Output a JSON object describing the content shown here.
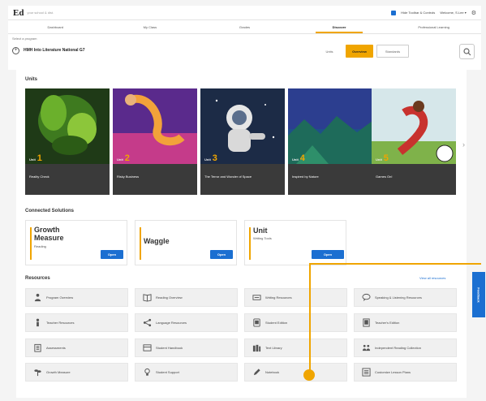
{
  "header": {
    "logo": "Ed",
    "org": "your school & dist.",
    "controls_label": "Hide Toolbar & Controls",
    "user": "Welcome, S.Lee ▾"
  },
  "nav": {
    "tabs": [
      "Dashboard",
      "My Class",
      "Grades",
      "Discover",
      "Professional Learning"
    ],
    "active_index": 3
  },
  "program": {
    "caption": "Select a program",
    "title": "HMH Into Literature National G7",
    "view_options": [
      "Units",
      "Overview",
      "Standards"
    ],
    "active_view": 1
  },
  "units": {
    "section_title": "Units",
    "items": [
      {
        "prefix": "Unit",
        "num": "1",
        "title": "Reality Check"
      },
      {
        "prefix": "Unit",
        "num": "2",
        "title": "Risky Business"
      },
      {
        "prefix": "Unit",
        "num": "3",
        "title": "The Terror and Wonder of Space"
      },
      {
        "prefix": "Unit",
        "num": "4",
        "title": "Inspired by Nature"
      },
      {
        "prefix": "Unit",
        "num": "5",
        "title": "Games On!"
      }
    ]
  },
  "solutions": {
    "section_title": "Connected Solutions",
    "items": [
      {
        "line1": "Growth",
        "line2": "Measure",
        "sub": "Reading",
        "button": "Open"
      },
      {
        "line1": "Waggle",
        "line2": "",
        "sub": "",
        "button": "Open"
      },
      {
        "line1": "Unit",
        "line2": "",
        "sub": "Writing Tools",
        "button": "Open"
      }
    ]
  },
  "resources": {
    "section_title": "Resources",
    "view_all": "View all resources",
    "items": [
      {
        "label": "Program Overview",
        "icon": "people-icon"
      },
      {
        "label": "Reading Overview",
        "icon": "book-icon"
      },
      {
        "label": "Writing Resources",
        "icon": "keyboard-icon"
      },
      {
        "label": "Speaking & Listening Resources",
        "icon": "chat-icon"
      },
      {
        "label": "Teacher Resources",
        "icon": "person-icon"
      },
      {
        "label": "Language Resources",
        "icon": "share-icon"
      },
      {
        "label": "Student Edition",
        "icon": "tablet-icon"
      },
      {
        "label": "Teacher's Edition",
        "icon": "book-tablet-icon"
      },
      {
        "label": "Assessments",
        "icon": "clipboard-icon"
      },
      {
        "label": "Student Handbook",
        "icon": "library-icon"
      },
      {
        "label": "Text Library",
        "icon": "books-icon"
      },
      {
        "label": "Independent Reading Collection",
        "icon": "group-icon"
      },
      {
        "label": "Growth Measure",
        "icon": "plant-icon"
      },
      {
        "label": "Student Support",
        "icon": "lightbulb-icon"
      },
      {
        "label": "Notebook",
        "icon": "pencil-icon"
      },
      {
        "label": "Customize Lesson Plans",
        "icon": "list-icon"
      }
    ]
  },
  "feedback_label": "Feedback",
  "colors": {
    "accent": "#f0a500",
    "primary": "#1b6fd1"
  }
}
